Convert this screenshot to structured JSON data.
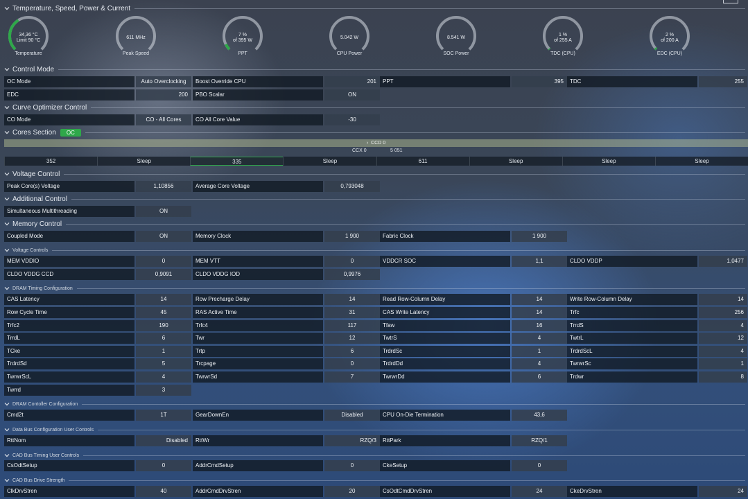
{
  "sections": {
    "temps": "Temperature, Speed, Power & Current",
    "control": "Control Mode",
    "curve": "Curve Optimizer Control",
    "cores": "Cores Section",
    "voltage": "Voltage Control",
    "additional": "Additional Control",
    "memory": "Memory Control",
    "mem_voltage": "Voltage Controls",
    "dram_timing": "DRAM Timing Configuration",
    "dram_ctrl": "DRAM Contoller Configuration",
    "data_bus": "Data Bus Configuration User Controls",
    "cad_timing": "CAD Bus Timing User Controls",
    "cad_drive": "CAD Bus Drive Strength"
  },
  "cores_badge": "OC",
  "gauges": [
    {
      "line1": "34,36 °C",
      "line2": "Limit 90 °C",
      "label": "Temperature",
      "fill": 0.38
    },
    {
      "line1": "611  MHz",
      "line2": "",
      "label": "Peak Speed",
      "fill": 0.0
    },
    {
      "line1": "7 %",
      "line2": "of 395 W",
      "label": "PPT",
      "fill": 0.07
    },
    {
      "line1": "5.042 W",
      "line2": "",
      "label": "CPU Power",
      "fill": 0.0
    },
    {
      "line1": "8.541 W",
      "line2": "",
      "label": "SOC Power",
      "fill": 0.0
    },
    {
      "line1": "1 %",
      "line2": "of 255 A",
      "label": "TDC (CPU)",
      "fill": 0.01
    },
    {
      "line1": "2 %",
      "line2": "of 200 A",
      "label": "EDC (CPU)",
      "fill": 0.02
    }
  ],
  "colors": {
    "accent": "#2fa84a"
  },
  "control_cells": [
    {
      "label": "OC Mode",
      "value": "Auto Overclocking",
      "center": true
    },
    {
      "label": "Boost Override CPU",
      "value": "201"
    },
    {
      "label": "PPT",
      "value": "395"
    },
    {
      "label": "TDC",
      "value": "255"
    },
    {
      "label": "EDC",
      "value": "200"
    },
    {
      "label": "PBO Scalar",
      "value": "ON",
      "center": true
    }
  ],
  "curve_cells": [
    {
      "label": "CO Mode",
      "value": "CO - All Cores",
      "center": true
    },
    {
      "label": "CO All Core Value",
      "value": "-30",
      "center": true
    }
  ],
  "cores": {
    "ccd": "CCD 0",
    "ccx": "CCX 0",
    "ccx_value": "5 051",
    "cells": [
      "352",
      "Sleep",
      "335",
      "Sleep",
      "611",
      "Sleep",
      "Sleep",
      "Sleep"
    ],
    "active": [
      false,
      false,
      true,
      false,
      false,
      false,
      false,
      false
    ]
  },
  "voltage_cells": [
    {
      "label": "Peak Core(s) Voltage",
      "value": "1,10856",
      "center": true
    },
    {
      "label": "Average Core Voltage",
      "value": "0,793048",
      "center": true
    }
  ],
  "additional_cells": [
    {
      "label": "Simultaneous Multithreading",
      "value": "ON",
      "center": true
    }
  ],
  "memory_cells": [
    {
      "label": "Coupled Mode",
      "value": "ON",
      "center": true
    },
    {
      "label": "Memory Clock",
      "value": "1 900",
      "center": true
    },
    {
      "label": "Fabric Clock",
      "value": "1 900",
      "center": true
    }
  ],
  "mem_voltage_cells": [
    {
      "label": "MEM VDDIO",
      "value": "0",
      "center": true
    },
    {
      "label": "MEM VTT",
      "value": "0",
      "center": true
    },
    {
      "label": "VDDCR SOC",
      "value": "1,1",
      "center": true
    },
    {
      "label": "CLDO VDDP",
      "value": "1,0477"
    },
    {
      "label": "CLDO VDDG CCD",
      "value": "0,9091",
      "center": true
    },
    {
      "label": "CLDO VDDG IOD",
      "value": "0,9976",
      "center": true
    }
  ],
  "dram_cells": [
    {
      "label": "CAS Latency",
      "value": "14",
      "center": true
    },
    {
      "label": "Row Precharge Delay",
      "value": "14",
      "center": true
    },
    {
      "label": "Read Row-Column Delay",
      "value": "14",
      "center": true
    },
    {
      "label": "Write Row-Column Delay",
      "value": "14"
    },
    {
      "label": "Row Cycle Time",
      "value": "45",
      "center": true
    },
    {
      "label": "RAS Active Time",
      "value": "31",
      "center": true
    },
    {
      "label": "CAS Write Latency",
      "value": "14",
      "center": true
    },
    {
      "label": "Trfc",
      "value": "256"
    },
    {
      "label": "Trfc2",
      "value": "190",
      "center": true
    },
    {
      "label": "Trfc4",
      "value": "117",
      "center": true
    },
    {
      "label": "Tfaw",
      "value": "16",
      "center": true
    },
    {
      "label": "TrrdS",
      "value": "4"
    },
    {
      "label": "TrrdL",
      "value": "6",
      "center": true
    },
    {
      "label": "Twr",
      "value": "12",
      "center": true
    },
    {
      "label": "TwtrS",
      "value": "4",
      "center": true
    },
    {
      "label": "TwtrL",
      "value": "12"
    },
    {
      "label": "TCke",
      "value": "1",
      "center": true
    },
    {
      "label": "Trtp",
      "value": "6",
      "center": true
    },
    {
      "label": "TrdrdSc",
      "value": "1",
      "center": true
    },
    {
      "label": "TrdrdScL",
      "value": "4"
    },
    {
      "label": "TrdrdSd",
      "value": "5",
      "center": true
    },
    {
      "label": "Trcpage",
      "value": "0",
      "center": true
    },
    {
      "label": "TrdrdDd",
      "value": "4",
      "center": true
    },
    {
      "label": "TwrwrSc",
      "value": "1"
    },
    {
      "label": "TwrwrScL",
      "value": "4",
      "center": true
    },
    {
      "label": "TwrwrSd",
      "value": "7",
      "center": true
    },
    {
      "label": "TwrwrDd",
      "value": "6",
      "center": true
    },
    {
      "label": "Trdwr",
      "value": "8"
    },
    {
      "label": "Twrrd",
      "value": "3",
      "center": true
    }
  ],
  "dram_ctrl_cells": [
    {
      "label": "Cmd2t",
      "value": "1T",
      "center": true
    },
    {
      "label": "GearDownEn",
      "value": "Disabled",
      "center": true
    },
    {
      "label": "CPU On-Die Termination",
      "value": "43,6",
      "center": true
    }
  ],
  "data_bus_cells": [
    {
      "label": "RttNom",
      "value": "Disabled"
    },
    {
      "label": "RttWr",
      "value": "RZQ/3"
    },
    {
      "label": "RttPark",
      "value": "RZQ/1",
      "center": true
    }
  ],
  "cad_timing_cells": [
    {
      "label": "CsOdtSetup",
      "value": "0",
      "center": true
    },
    {
      "label": "AddrCmdSetup",
      "value": "0",
      "center": true
    },
    {
      "label": "CkeSetup",
      "value": "0",
      "center": true
    }
  ],
  "cad_drive_cells": [
    {
      "label": "ClkDrvStren",
      "value": "40",
      "center": true
    },
    {
      "label": "AddrCmdDrvStren",
      "value": "20",
      "center": true
    },
    {
      "label": "CsOdtCmdDrvStren",
      "value": "24",
      "center": true
    },
    {
      "label": "CkeDrvStren",
      "value": "24"
    }
  ]
}
